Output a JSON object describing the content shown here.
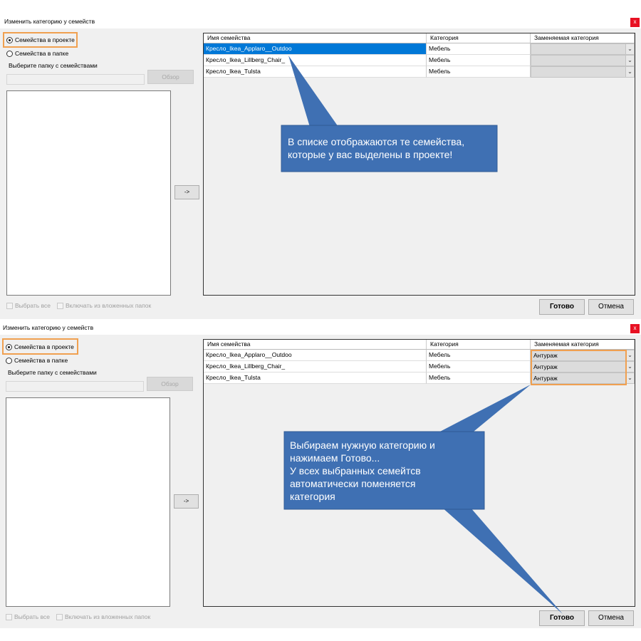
{
  "dialog_top": {
    "title": "Изменить категорию у семейств",
    "close_label": "x",
    "radio_project": "Семейства в проекте",
    "radio_folder": "Семейства в папке",
    "folder_prompt": "Выберите папку с семействами",
    "browse_label": "Обзор",
    "arrow_label": "->",
    "select_all": "Выбрать все",
    "include_subfolders": "Включать из вложенных папок",
    "columns": [
      "Имя семейства",
      "Категория",
      "Заменяемая категория"
    ],
    "rows": [
      {
        "name": "Кресло_Ikea_Applaro__Outdoo",
        "category": "Мебель",
        "replace": ""
      },
      {
        "name": "Кресло_Ikea_Lillberg_Chair_",
        "category": "Мебель",
        "replace": ""
      },
      {
        "name": "Кресло_Ikea_Tulsta",
        "category": "Мебель",
        "replace": ""
      }
    ],
    "ok_label": "Готово",
    "cancel_label": "Отмена",
    "callout": "В списке отображаются те семейства, которые у вас выделены в проекте!"
  },
  "dialog_bottom": {
    "title": "Изменить категорию у семейств",
    "close_label": "x",
    "radio_project": "Семейства в проекте",
    "radio_folder": "Семейства в папке",
    "folder_prompt": "Выберите папку с семействами",
    "browse_label": "Обзор",
    "arrow_label": "->",
    "select_all": "Выбрать все",
    "include_subfolders": "Включать из вложенных папок",
    "columns": [
      "Имя семейства",
      "Категория",
      "Заменяемая категория"
    ],
    "rows": [
      {
        "name": "Кресло_Ikea_Applaro__Outdoo",
        "category": "Мебель",
        "replace": "Антураж"
      },
      {
        "name": "Кресло_Ikea_Lillberg_Chair_",
        "category": "Мебель",
        "replace": "Антураж"
      },
      {
        "name": "Кресло_Ikea_Tulsta",
        "category": "Мебель",
        "replace": "Антураж"
      }
    ],
    "ok_label": "Готово",
    "cancel_label": "Отмена",
    "callout_lines": [
      "Выбираем нужную категорию и",
      "нажимаем Готово...",
      "У всех выбранных семейтсв",
      "автоматически поменяется",
      "категория"
    ]
  },
  "colors": {
    "callout_fill": "#3f70b3",
    "highlight": "#f0a050",
    "selection": "#0078d7",
    "close": "#e81123"
  }
}
